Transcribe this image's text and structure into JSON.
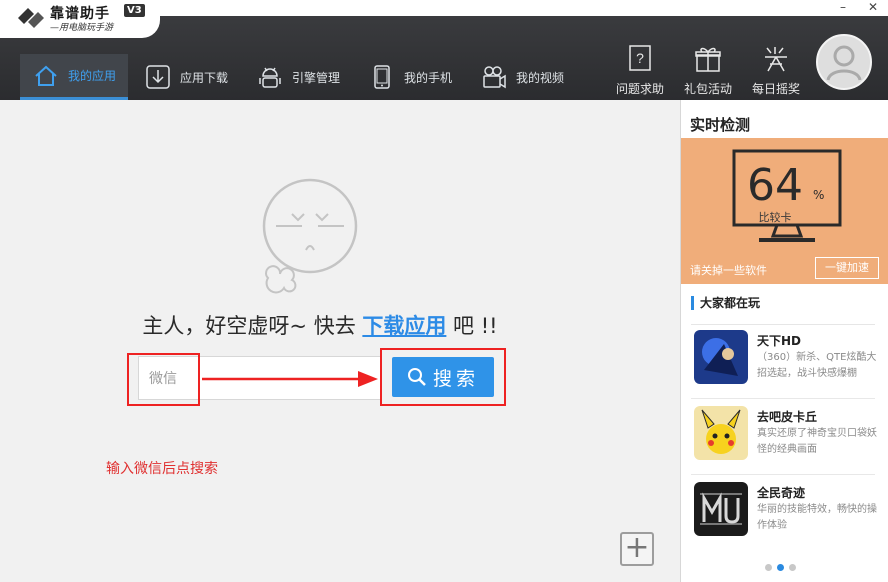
{
  "app": {
    "name": "靠谱助手",
    "version": "V3",
    "slogan": "—用电脑玩手游"
  },
  "window": {
    "minimize": "–",
    "close": "✕"
  },
  "nav": {
    "items": [
      {
        "label": "我的应用",
        "icon": "home-icon"
      },
      {
        "label": "应用下载",
        "icon": "download-icon"
      },
      {
        "label": "引擎管理",
        "icon": "android-icon"
      },
      {
        "label": "我的手机",
        "icon": "phone-icon"
      },
      {
        "label": "我的视频",
        "icon": "video-icon"
      }
    ],
    "right": [
      {
        "label": "问题求助",
        "icon": "help-icon"
      },
      {
        "label": "礼包活动",
        "icon": "gift-icon"
      },
      {
        "label": "每日摇奖",
        "icon": "lottery-icon"
      }
    ]
  },
  "main": {
    "empty_prefix": "主人，好空虚呀~ 快去 ",
    "empty_link": "下载应用",
    "empty_suffix": " 吧 !!",
    "search_value": "微信",
    "search_button": "搜索",
    "annotation": "输入微信后点搜索",
    "add_button": "+"
  },
  "panel": {
    "title": "实时检测",
    "score": "64",
    "percent": "%",
    "score_label": "比较卡",
    "close_hint": "请关掉一些软件",
    "speed_button": "一键加速",
    "section_title": "大家都在玩",
    "games": [
      {
        "name": "天下HD",
        "desc": "（360）新杀、QTE炫酷大招选起，战斗快感爆棚"
      },
      {
        "name": "去吧皮卡丘",
        "desc": "真实还原了神奇宝贝口袋妖怪的经典画面"
      },
      {
        "name": "全民奇迹",
        "desc": "华丽的技能特效，畅快的操作体验"
      }
    ]
  },
  "colors": {
    "accent": "#2f93e8",
    "navbar": "#2f3033",
    "monitor_bg": "#f0ad7a",
    "annotation": "#e22222"
  }
}
